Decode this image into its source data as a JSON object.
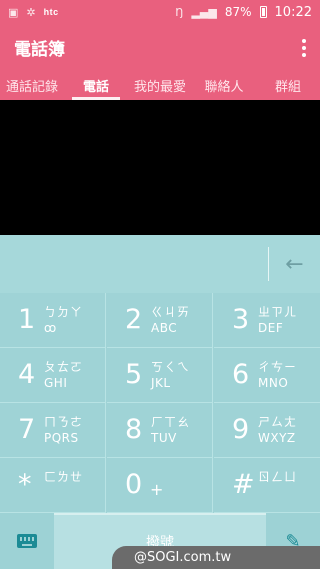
{
  "status_bar": {
    "icons_left": [
      "image-icon",
      "settings-icon"
    ],
    "brand": "htc",
    "battery": "87%",
    "time": "10:22"
  },
  "app": {
    "title": "電話簿"
  },
  "tabs": [
    {
      "label": "通話記錄",
      "active": false
    },
    {
      "label": "電話",
      "active": true
    },
    {
      "label": "我的最愛",
      "active": false
    },
    {
      "label": "聯絡人",
      "active": false
    },
    {
      "label": "群組",
      "active": false
    }
  ],
  "keypad": {
    "keys": [
      {
        "digit": "1",
        "bpmf": "ㄅㄉㄚ",
        "letters": "ꝏ"
      },
      {
        "digit": "2",
        "bpmf": "ㄍㄐㄞ",
        "letters": "ABC"
      },
      {
        "digit": "3",
        "bpmf": "ㄓㄗㄦ",
        "letters": "DEF"
      },
      {
        "digit": "4",
        "bpmf": "ㄆㄊㄛ",
        "letters": "GHI"
      },
      {
        "digit": "5",
        "bpmf": "ㄎㄑㄟ",
        "letters": "JKL"
      },
      {
        "digit": "6",
        "bpmf": "ㄔㄘㄧ",
        "letters": "MNO"
      },
      {
        "digit": "7",
        "bpmf": "ㄇㄋㄜ",
        "letters": "PQRS"
      },
      {
        "digit": "8",
        "bpmf": "ㄏㄒㄠ",
        "letters": "TUV"
      },
      {
        "digit": "9",
        "bpmf": "ㄕㄙㄤ",
        "letters": "WXYZ"
      },
      {
        "digit": "*",
        "bpmf": "ㄈㄌㄝ",
        "letters": ""
      },
      {
        "digit": "0",
        "bpmf": "",
        "letters": "+"
      },
      {
        "digit": "#",
        "bpmf": "ㄖㄥㄩ",
        "letters": ""
      }
    ]
  },
  "bottom": {
    "dial_label": "撥號"
  },
  "watermark": "@SOGI.com.tw",
  "colors": {
    "accent": "#e9607e",
    "keypad_bg": "#9fd3d6",
    "icon_teal": "#1c8b95"
  }
}
